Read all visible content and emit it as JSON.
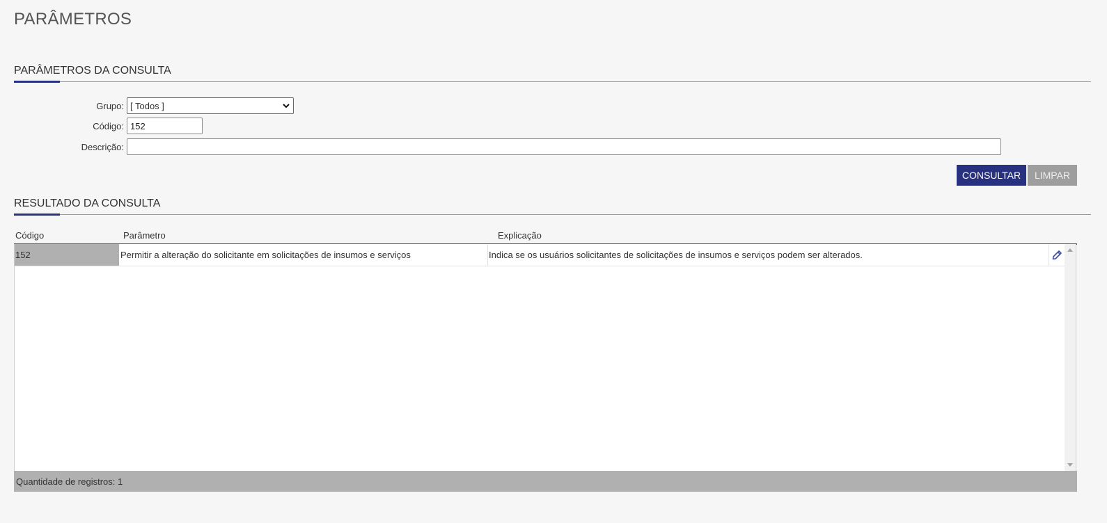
{
  "page": {
    "title": "PARÂMETROS"
  },
  "query_section": {
    "title": "PARÂMETROS DA CONSULTA"
  },
  "form": {
    "group_label": "Grupo:",
    "group_value": "[ Todos ]",
    "code_label": "Código:",
    "code_value": "152",
    "description_label": "Descrição:",
    "description_value": ""
  },
  "buttons": {
    "search_label": "CONSULTAR",
    "clear_label": "LIMPAR"
  },
  "result_section": {
    "title": "RESULTADO DA CONSULTA"
  },
  "grid": {
    "columns": [
      "Código",
      "Parâmetro",
      "Explicação"
    ],
    "rows": [
      {
        "code": "152",
        "parameter": "Permitir a alteração do solicitante em solicitações de insumos e serviços",
        "explanation": "Indica se os usuários solicitantes de solicitações de insumos e serviços podem ser alterados.",
        "action_icon": "pencil-edit-icon"
      }
    ],
    "footer": "Quantidade de registros: 1"
  },
  "colors": {
    "accent": "#283080",
    "secondary_button": "#9e9e9e",
    "grid_footer": "#b0b0b0",
    "background": "#f6f6f6"
  }
}
